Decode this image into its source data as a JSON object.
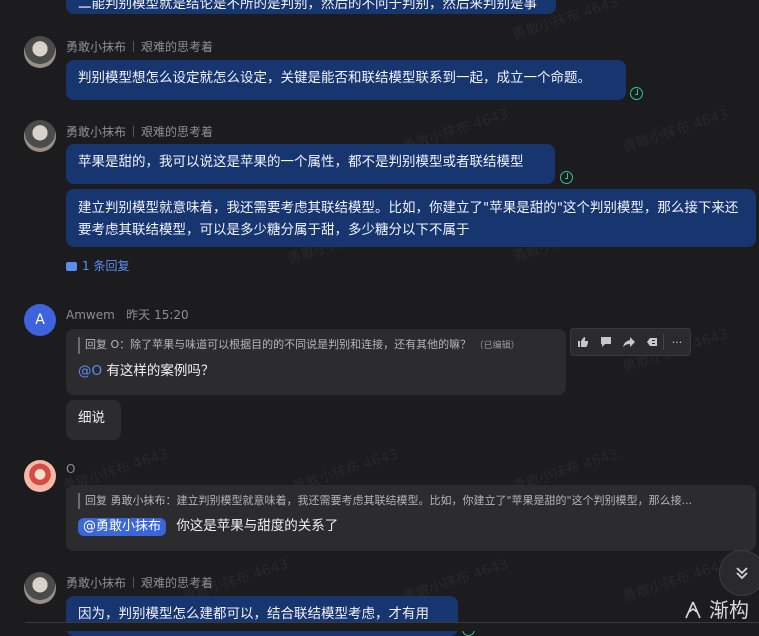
{
  "top_fragment": "二能判别模型就是结论是不所的是判别，然后的不问于判别，然后来判别是事实",
  "messages": [
    {
      "author": "勇敢小抹布",
      "title": "艰难的思考着",
      "bubbles": [
        "判别模型想怎么设定就怎么设定，关键是能否和联结模型联系到一起，成立一个命题。"
      ]
    },
    {
      "author": "勇敢小抹布",
      "title": "艰难的思考着",
      "bubbles": [
        "苹果是甜的，我可以说这是苹果的一个属性，都不是判别模型或者联结模型",
        "建立判别模型就意味着，我还需要考虑其联结模型。比如，你建立了\"苹果是甜的\"这个判别模型，那么接下来还要考虑其联结模型，可以是多少糖分属于甜，多少糖分以下不属于"
      ],
      "reply_count": "1 条回复"
    },
    {
      "author": "Amwem",
      "avatar_letter": "A",
      "time": "昨天 15:20",
      "quote": "回复 O：除了苹果与味道可以根据目的的不同说是判别和连接，还有其他的嘛？",
      "edited": "（已编辑）",
      "mention": "@O",
      "text": "有这样的案例吗？",
      "bubble2": "细说"
    },
    {
      "author": "O",
      "quote": "回复 勇敢小抹布：建立判别模型就意味着，我还需要考虑其联结模型。比如，你建立了\"苹果是甜的\"这个判别模型，那么接...",
      "mention": "@勇敢小抹布",
      "text": "你这是苹果与甜度的关系了"
    },
    {
      "author": "勇敢小抹布",
      "title": "艰难的思考着",
      "bubbles": [
        "因为，判别模型怎么建都可以，结合联结模型考虑，才有用"
      ]
    }
  ],
  "toolbar": {
    "icons": [
      "thumbs-up-icon",
      "comment-icon",
      "forward-icon",
      "quote-icon",
      "more-icon"
    ],
    "more_label": "···"
  },
  "watermark_text": "勇敢小抹布 4643",
  "brand": "渐构",
  "colors": {
    "background": "#1c1c1e",
    "own_bubble": "#17356f",
    "other_bubble": "#2c2c2f",
    "accent": "#5b8df0",
    "read_check": "#2fc39a"
  }
}
